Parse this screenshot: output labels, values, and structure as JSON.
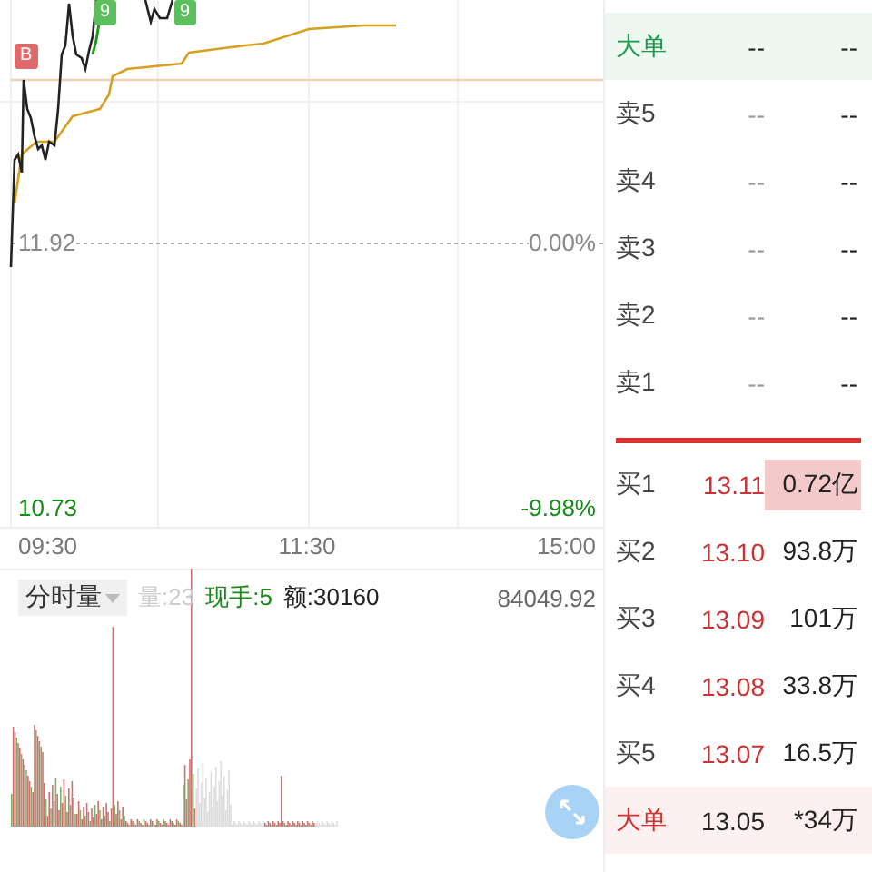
{
  "price_chart": {
    "markers": [
      {
        "kind": "buy",
        "label": "B"
      },
      {
        "kind": "sell",
        "label": "9"
      },
      {
        "kind": "sell",
        "label": "9"
      }
    ],
    "reference_price": "11.92",
    "reference_change": "0.00%",
    "low_price": "10.73",
    "low_change": "-9.98%",
    "time_axis": [
      "09:30",
      "11:30",
      "15:00"
    ]
  },
  "volume_panel": {
    "selector": {
      "label": "分时量"
    },
    "volume": "量:23",
    "current_hand": "现手:5",
    "amount": "额:30160",
    "max_volume": "84049.92"
  },
  "order_book": {
    "sell_rows": [
      {
        "kind": "big",
        "label": "大单",
        "price": "--",
        "volume": "--",
        "highlighted": false
      },
      {
        "kind": "level",
        "label": "卖5",
        "price": "--",
        "volume": "--",
        "highlighted": false
      },
      {
        "kind": "level",
        "label": "卖4",
        "price": "--",
        "volume": "--",
        "highlighted": false
      },
      {
        "kind": "level",
        "label": "卖3",
        "price": "--",
        "volume": "--",
        "highlighted": false
      },
      {
        "kind": "level",
        "label": "卖2",
        "price": "--",
        "volume": "--",
        "highlighted": false
      },
      {
        "kind": "level",
        "label": "卖1",
        "price": "--",
        "volume": "--",
        "highlighted": false
      }
    ],
    "buy_rows": [
      {
        "kind": "level",
        "label": "买1",
        "price": "13.11",
        "volume": "0.72亿",
        "highlighted": true
      },
      {
        "kind": "level",
        "label": "买2",
        "price": "13.10",
        "volume": "93.8万",
        "highlighted": false
      },
      {
        "kind": "level",
        "label": "买3",
        "price": "13.09",
        "volume": "101万",
        "highlighted": false
      },
      {
        "kind": "level",
        "label": "买4",
        "price": "13.08",
        "volume": "33.8万",
        "highlighted": false
      },
      {
        "kind": "level",
        "label": "买5",
        "price": "13.07",
        "volume": "16.5万",
        "highlighted": false
      },
      {
        "kind": "big",
        "label": "大单",
        "price": "13.05",
        "volume": "*34万",
        "highlighted": false
      }
    ]
  }
}
